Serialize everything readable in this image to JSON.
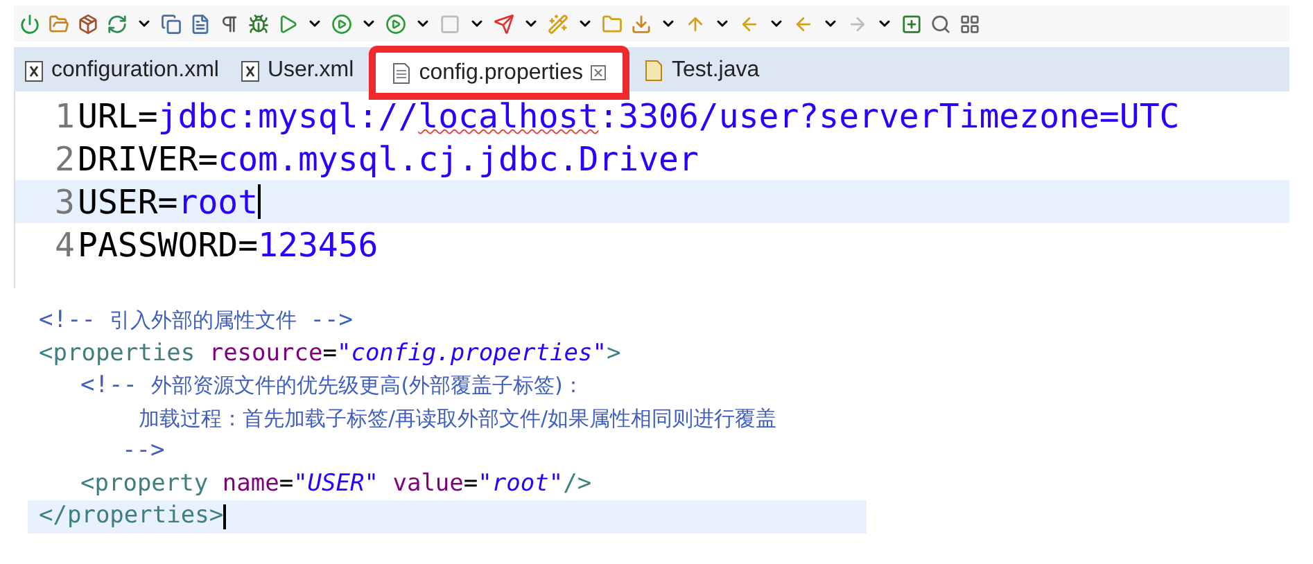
{
  "tabs": [
    {
      "label": "configuration.xml",
      "kind": "xml",
      "selected": false,
      "highlighted": false
    },
    {
      "label": "User.xml",
      "kind": "xml",
      "selected": false,
      "highlighted": false
    },
    {
      "label": "config.properties",
      "kind": "properties",
      "selected": true,
      "highlighted": true
    },
    {
      "label": "Test.java",
      "kind": "java",
      "selected": false,
      "highlighted": false
    }
  ],
  "editor": {
    "lines": [
      {
        "number": "1",
        "selected": false,
        "caret": false,
        "tokens": [
          {
            "kind": "key",
            "text": "URL="
          },
          {
            "kind": "value",
            "text": "jdbc:mysql://"
          },
          {
            "kind": "value_misspelled",
            "text": "localhost"
          },
          {
            "kind": "value",
            "text": ":3306/user?serverTimezone=UTC"
          }
        ]
      },
      {
        "number": "2",
        "selected": false,
        "caret": false,
        "tokens": [
          {
            "kind": "key",
            "text": "DRIVER="
          },
          {
            "kind": "value",
            "text": "com.mysql.cj.jdbc.Driver"
          }
        ]
      },
      {
        "number": "3",
        "selected": true,
        "caret": true,
        "tokens": [
          {
            "kind": "key",
            "text": "USER="
          },
          {
            "kind": "value",
            "text": "root"
          }
        ]
      },
      {
        "number": "4",
        "selected": false,
        "caret": false,
        "tokens": [
          {
            "kind": "key",
            "text": "PASSWORD="
          },
          {
            "kind": "value",
            "text": "123456"
          }
        ]
      }
    ]
  },
  "xml_snippet": {
    "lines": [
      {
        "selected": false,
        "caret": false,
        "tokens": [
          {
            "kind": "comment",
            "text": "<!--"
          },
          {
            "kind": "comment_cjk",
            "text": "引入外部的属性文件"
          },
          {
            "kind": "comment",
            "text": "-->"
          }
        ]
      },
      {
        "selected": false,
        "caret": false,
        "tokens": [
          {
            "kind": "tag",
            "text": "<properties"
          },
          {
            "kind": "attr",
            "text": "resource"
          },
          {
            "kind": "plain",
            "text": "="
          },
          {
            "kind": "string",
            "text": "\"config.properties\""
          },
          {
            "kind": "tag",
            "text": ">"
          }
        ],
        "children": [
          {
            "selected": false,
            "caret": false,
            "tokens": [
              {
                "kind": "comment",
                "text": "<!--"
              },
              {
                "kind": "comment_cjk",
                "text": "外部资源文件的优先级更高(外部覆盖子标签)："
              }
            ],
            "children": [
              {
                "selected": false,
                "caret": false,
                "tokens": [
                  {
                    "kind": "comment_cjk",
                    "text": "加载过程：首先加载子标签/再读取外部文件/如果属性相同则进行覆盖"
                  }
                ]
              },
              {
                "selected": false,
                "caret": false,
                "tokens": [
                  {
                    "kind": "comment",
                    "text": "-->"
                  }
                ]
              }
            ]
          },
          {
            "selected": false,
            "caret": false,
            "tokens": [
              {
                "kind": "tag",
                "text": "<property"
              },
              {
                "kind": "attr",
                "text": "name"
              },
              {
                "kind": "plain",
                "text": "="
              },
              {
                "kind": "string",
                "text": "\"USER\""
              },
              {
                "kind": "attr",
                "text": "value"
              },
              {
                "kind": "plain",
                "text": "="
              },
              {
                "kind": "string",
                "text": "\"root\""
              },
              {
                "kind": "tag",
                "text": "/>"
              }
            ]
          }
        ]
      },
      {
        "selected": true,
        "caret": true,
        "tokens": [
          {
            "kind": "tag",
            "text": "</properties>"
          }
        ]
      }
    ]
  }
}
